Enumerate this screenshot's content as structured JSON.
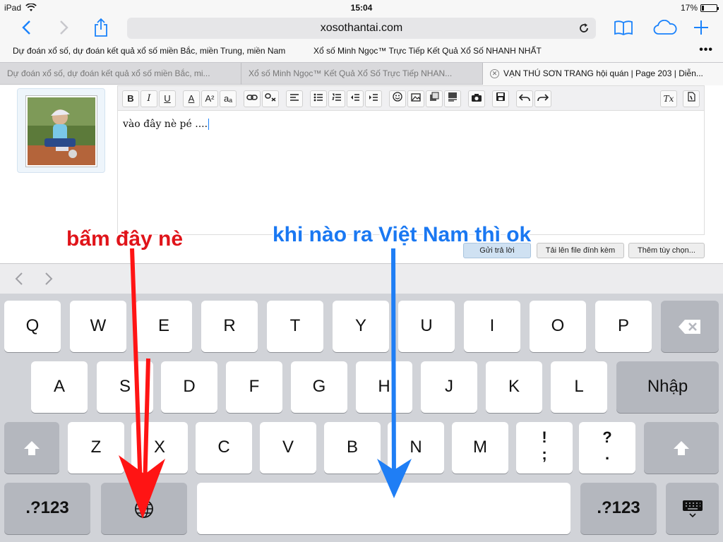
{
  "status": {
    "device": "iPad",
    "time": "15:04",
    "battery": "17%",
    "battery_level": 0.17
  },
  "toolbar": {
    "url": "xosothantai.com"
  },
  "bookmarks": [
    "Dự đoán xổ số, dự đoán kết quả xổ số miền Bắc, miền Trung, miền Nam",
    "Xổ số Minh Ngọc™ Trực Tiếp Kết Quả Xổ Số NHANH NHẤT"
  ],
  "tabs": [
    "Dự đoán xổ số, dự đoán kết quả xổ số miền Bắc, mi...",
    "Xổ số Minh Ngọc™ Kết Quả Xổ Số Trực Tiếp NHAN...",
    "VẠN THÚ SƠN TRANG hội quán | Page 203 | Diễn..."
  ],
  "editor": {
    "text": "vào đây nè pé ....",
    "toolbar_bold": "B",
    "toolbar_italic": "I",
    "toolbar_underline": "U",
    "toolbar_color": "A",
    "toolbar_size": "A²",
    "toolbar_font": "aₐ",
    "toolbar_clear": "Tx"
  },
  "form_buttons": {
    "submit": "Gửi trả lời",
    "upload": "Tải lên file đính kèm",
    "more": "Thêm tùy chọn..."
  },
  "keyboard": {
    "row1": [
      "Q",
      "W",
      "E",
      "R",
      "T",
      "Y",
      "U",
      "I",
      "O",
      "P"
    ],
    "row2": [
      "A",
      "S",
      "D",
      "F",
      "G",
      "H",
      "J",
      "K",
      "L"
    ],
    "row3": [
      "Z",
      "X",
      "C",
      "V",
      "B",
      "N",
      "M"
    ],
    "enter": "Nhập",
    "excl": "!",
    "comma": ";",
    "question": "?",
    "period": ".",
    "numbers_left": ".?123",
    "numbers_right": ".?123"
  },
  "annotations": {
    "red": "bấm đây nè",
    "blue": "khi nào ra Việt Nam thì ok"
  },
  "colors": {
    "ios_blue": "#1a82fb",
    "annotation_red": "#e0141a",
    "annotation_blue": "#1a78f2",
    "keyboard_bg": "#d1d3d8"
  }
}
